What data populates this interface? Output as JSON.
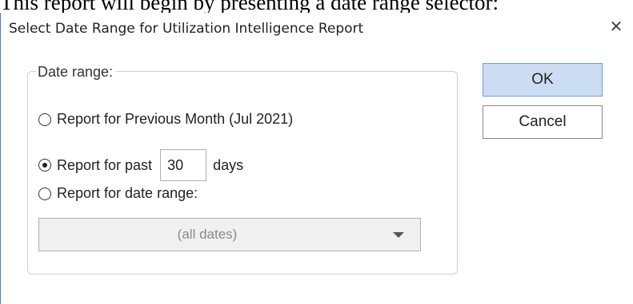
{
  "caption": "This report will begin by presenting a date range selector:",
  "dialog": {
    "title": "Select Date Range for Utilization Intelligence Report",
    "close_symbol": "✕",
    "icons": {
      "close": "close-icon",
      "dropdown": "chevron-down-icon"
    }
  },
  "date_range": {
    "legend": "Date range:",
    "options": [
      {
        "label": "Report for Previous Month (Jul 2021)",
        "selected": false
      },
      {
        "label_before": "Report for past",
        "label_after": "days",
        "selected": true
      },
      {
        "label": "Report for date range:",
        "selected": false
      }
    ],
    "past_days_value": "30",
    "date_select_value": "(all dates)"
  },
  "buttons": {
    "ok": "OK",
    "cancel": "Cancel"
  }
}
